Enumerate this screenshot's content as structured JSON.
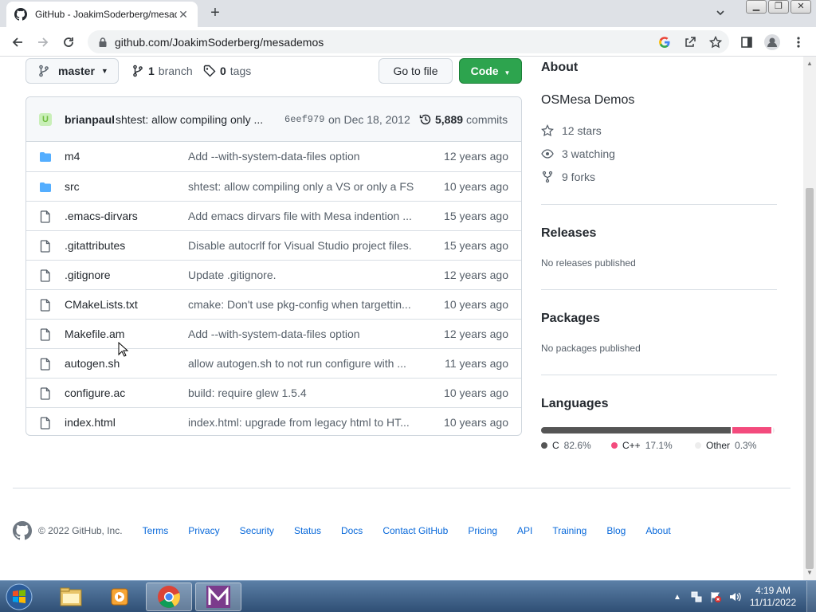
{
  "browser": {
    "tab_title": "GitHub - JoakimSoderberg/mesademos",
    "new_tab": "+",
    "url": "github.com/JoakimSoderberg/mesademos"
  },
  "repo_bar": {
    "branch": "master",
    "branches_count": "1",
    "branches_label": "branch",
    "tags_count": "0",
    "tags_label": "tags",
    "goto_file": "Go to file",
    "code": "Code"
  },
  "commit": {
    "avatar_letter": "U",
    "author": "brianpaul",
    "message": "shtest: allow compiling only ...",
    "sha": "6eef979",
    "date": "on Dec 18, 2012",
    "count": "5,889",
    "count_label": "commits"
  },
  "files": [
    {
      "type": "dir",
      "name": "m4",
      "message": "Add --with-system-data-files option",
      "age": "12 years ago"
    },
    {
      "type": "dir",
      "name": "src",
      "message": "shtest: allow compiling only a VS or only a FS",
      "age": "10 years ago"
    },
    {
      "type": "file",
      "name": ".emacs-dirvars",
      "message": "Add emacs dirvars file with Mesa indention ...",
      "age": "15 years ago"
    },
    {
      "type": "file",
      "name": ".gitattributes",
      "message": "Disable autocrlf for Visual Studio project files.",
      "age": "15 years ago"
    },
    {
      "type": "file",
      "name": ".gitignore",
      "message": "Update .gitignore.",
      "age": "12 years ago"
    },
    {
      "type": "file",
      "name": "CMakeLists.txt",
      "message": "cmake: Don't use pkg-config when targettin...",
      "age": "10 years ago"
    },
    {
      "type": "file",
      "name": "Makefile.am",
      "message": "Add --with-system-data-files option",
      "age": "12 years ago"
    },
    {
      "type": "file",
      "name": "autogen.sh",
      "message": "allow autogen.sh to not run configure with ...",
      "age": "11 years ago"
    },
    {
      "type": "file",
      "name": "configure.ac",
      "message": "build: require glew 1.5.4",
      "age": "10 years ago"
    },
    {
      "type": "file",
      "name": "index.html",
      "message": "index.html: upgrade from legacy html to HT...",
      "age": "10 years ago"
    }
  ],
  "sidebar": {
    "about_heading": "About",
    "description": "OSMesa Demos",
    "stars": "12 stars",
    "watching": "3 watching",
    "forks": "9 forks",
    "releases_heading": "Releases",
    "releases_sub": "No releases published",
    "packages_heading": "Packages",
    "packages_sub": "No packages published",
    "languages_heading": "Languages",
    "languages": [
      {
        "name": "C",
        "percent": "82.6%",
        "value": 82.6,
        "color": "#555555"
      },
      {
        "name": "C++",
        "percent": "17.1%",
        "value": 17.1,
        "color": "#f34b7d"
      },
      {
        "name": "Other",
        "percent": "0.3%",
        "value": 0.3,
        "color": "#ededed"
      }
    ]
  },
  "footer": {
    "copyright": "© 2022 GitHub, Inc.",
    "links": [
      "Terms",
      "Privacy",
      "Security",
      "Status",
      "Docs",
      "Contact GitHub",
      "Pricing",
      "API",
      "Training",
      "Blog",
      "About"
    ]
  },
  "taskbar": {
    "time": "4:19 AM",
    "date": "11/11/2022"
  },
  "colors": {
    "accent_green": "#2da44e",
    "link_blue": "#0969da",
    "folder_blue": "#54aeff"
  }
}
